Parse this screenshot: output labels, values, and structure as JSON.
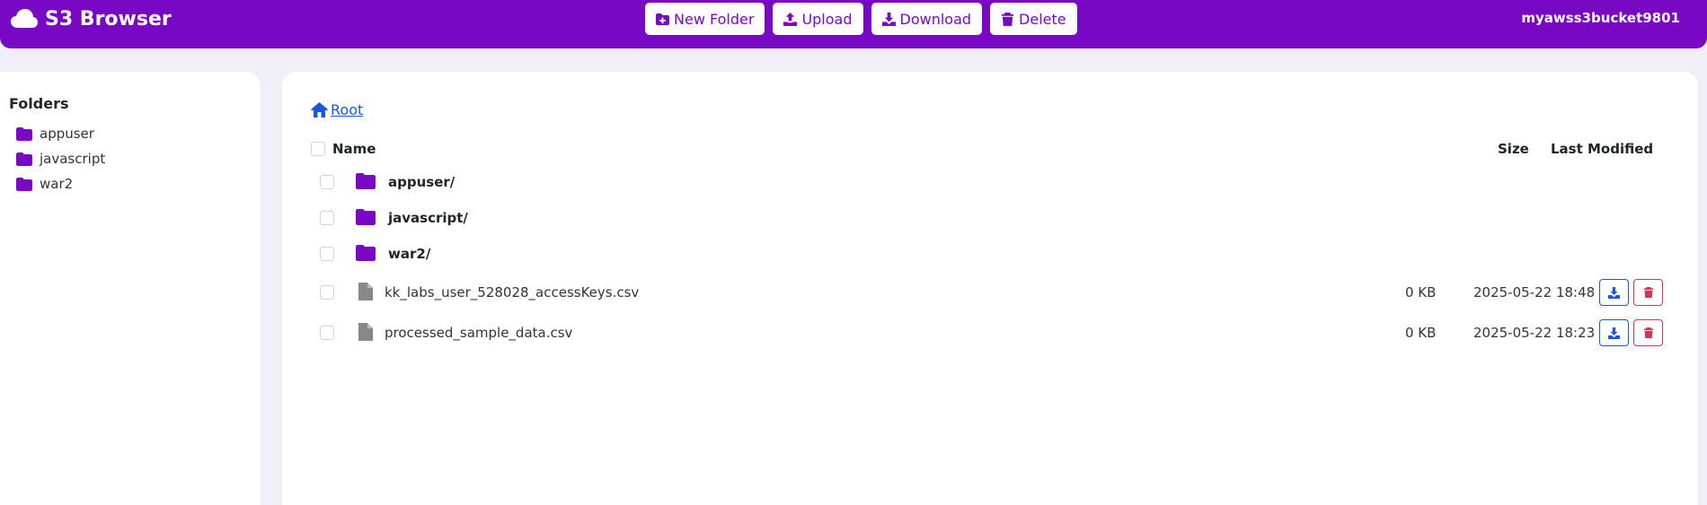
{
  "app": {
    "title": "S3 Browser",
    "bucket": "myawss3bucket9801"
  },
  "toolbar": {
    "new_folder": "New Folder",
    "upload": "Upload",
    "download": "Download",
    "delete": "Delete"
  },
  "sidebar": {
    "heading": "Folders",
    "items": [
      {
        "label": "appuser"
      },
      {
        "label": "javascript"
      },
      {
        "label": "war2"
      }
    ]
  },
  "breadcrumb": {
    "root": "Root"
  },
  "table": {
    "headers": {
      "name": "Name",
      "size": "Size",
      "modified": "Last Modified"
    },
    "folders": [
      {
        "name": "appuser/"
      },
      {
        "name": "javascript/"
      },
      {
        "name": "war2/"
      }
    ],
    "files": [
      {
        "name": "kk_labs_user_528028_accessKeys.csv",
        "size": "0 KB",
        "modified": "2025-05-22 18:48"
      },
      {
        "name": "processed_sample_data.csv",
        "size": "0 KB",
        "modified": "2025-05-22 18:23"
      }
    ]
  },
  "icons": {
    "brand": "cloud-icon",
    "folder": "folder-icon",
    "file": "file-icon",
    "download": "download-icon",
    "delete": "trash-icon",
    "home": "home-icon"
  },
  "colors": {
    "accent": "#7808c3",
    "link": "#1a56db",
    "danger": "#dc2f5a",
    "background": "#f0eff7"
  }
}
